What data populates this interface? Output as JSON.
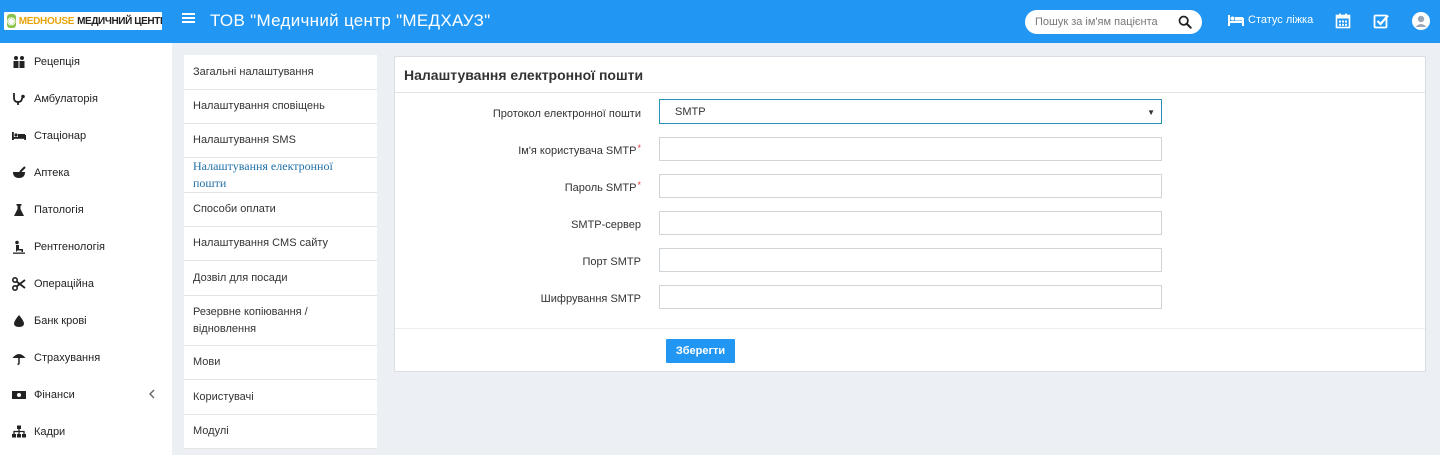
{
  "topbar": {
    "logo_brand": "MEDHOUSE",
    "logo_name": "МЕДИЧНИЙ ЦЕНТР",
    "title": "ТОВ \"Медичний центр \"МЕДХАУЗ\"",
    "search_placeholder": "Пошук за ім'ям пацієнта",
    "bed_status_label": "Статус ліжка",
    "color": "#2196f3"
  },
  "sidebar": {
    "items": [
      {
        "label": "Рецепція",
        "icon": "reception-icon"
      },
      {
        "label": "Амбулаторія",
        "icon": "stethoscope-icon"
      },
      {
        "label": "Стаціонар",
        "icon": "bed-icon"
      },
      {
        "label": "Аптека",
        "icon": "mortar-pestle-icon"
      },
      {
        "label": "Патологія",
        "icon": "flask-icon"
      },
      {
        "label": "Рентгенологія",
        "icon": "xray-icon"
      },
      {
        "label": "Операційна",
        "icon": "scissors-icon"
      },
      {
        "label": "Банк крові",
        "icon": "blood-drop-icon"
      },
      {
        "label": "Страхування",
        "icon": "umbrella-icon"
      },
      {
        "label": "Фінанси",
        "icon": "money-icon"
      },
      {
        "label": "Кадри",
        "icon": "sitemap-icon"
      }
    ]
  },
  "settings_menu": {
    "items": [
      "Загальні налаштування",
      "Налаштування сповіщень",
      "Налаштування SMS",
      "Налаштування електронної пошти",
      "Способи оплати",
      "Налаштування CMS сайту",
      "Дозвіл для посади",
      "Резервне копіювання / відновлення",
      "Мови",
      "Користувачі",
      "Модулі"
    ],
    "active": "Налаштування електронної пошти"
  },
  "panel": {
    "title": "Налаштування електронної пошти",
    "protocol_label": "Протокол електронної пошти",
    "protocol_value": "SMTP",
    "username_label": "Ім'я користувача SMTP",
    "password_label": "Пароль SMTP",
    "server_label": "SMTP-сервер",
    "port_label": "Порт SMTP",
    "encryption_label": "Шифрування SMTP",
    "required_mark": "*",
    "save_label": "Зберегти"
  }
}
